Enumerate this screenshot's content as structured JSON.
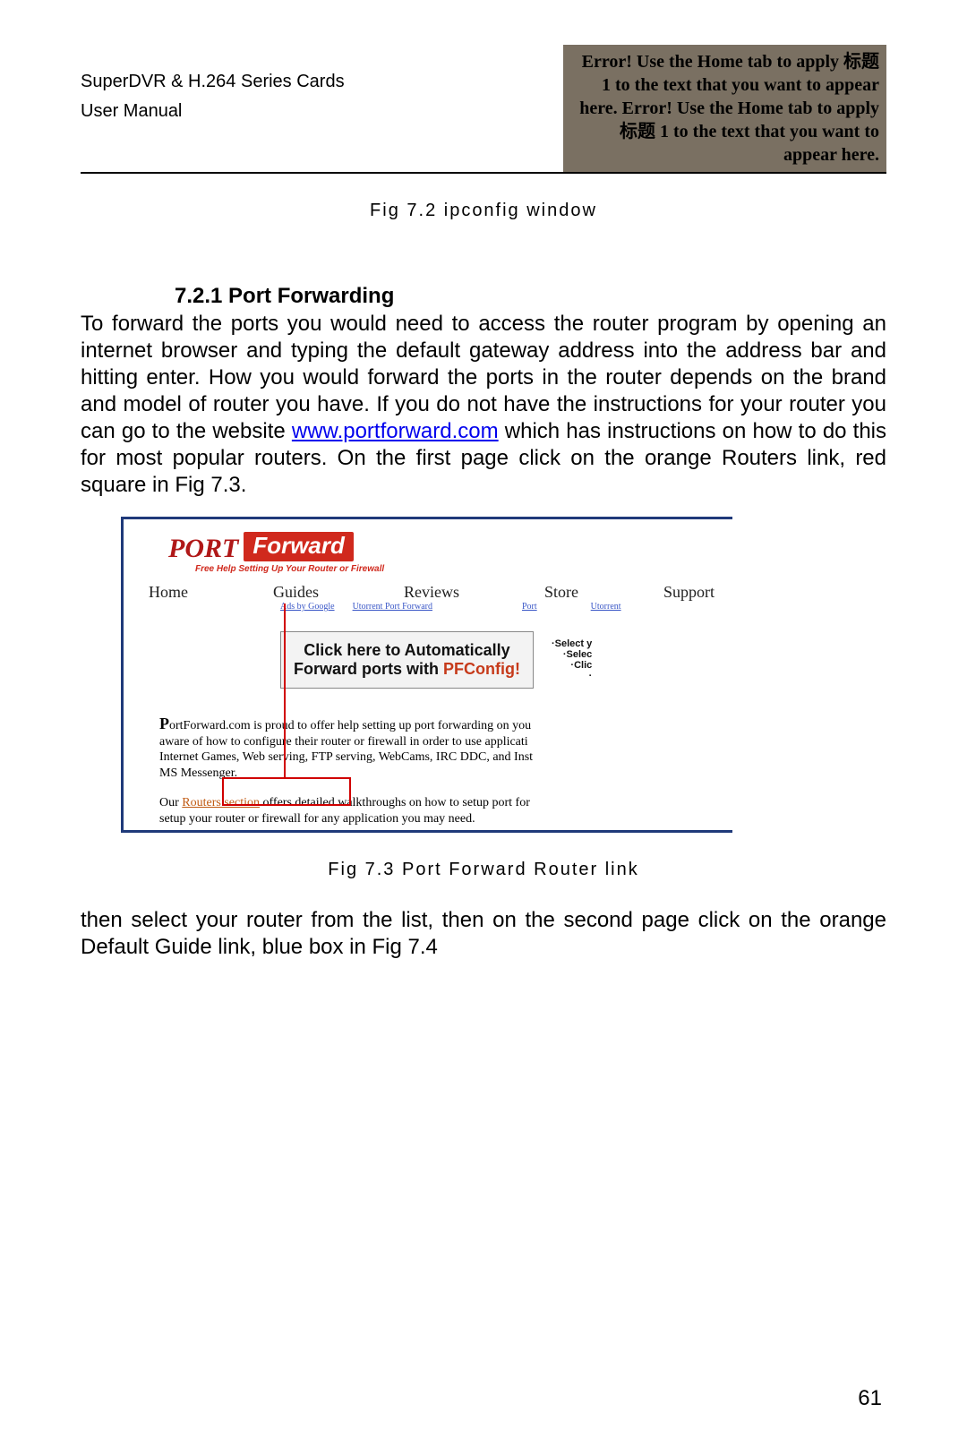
{
  "header": {
    "left_line1": "SuperDVR & H.264 Series Cards",
    "left_line2": "User Manual",
    "right_text": "Error! Use the Home tab to apply 标题 1 to the text that you want to appear here. Error! Use the Home tab to apply 标题 1 to the text that you want to appear here."
  },
  "fig72_caption": "Fig 7.2 ipconfig window",
  "section": {
    "number_title": "7.2.1  Port Forwarding",
    "para1_a": "To forward the ports you would need to access the router program by opening an internet browser and typing the default gateway address into the address bar and hitting enter. How you would forward the ports in the router depends on the brand and model of router you have. If you do not have the instructions for your router you can go to the website ",
    "link1": "www.portforward.com",
    "para1_b": " which has instructions on how to do this for most popular routers. On the first page click on the orange Routers link, red square in Fig 7.3."
  },
  "portforward": {
    "logo_port": "PORT",
    "logo_fwd": "Forward",
    "tagline": "Free Help Setting Up Your Router or Firewall",
    "nav": [
      "Home",
      "Guides",
      "Reviews",
      "Store",
      "Support"
    ],
    "subnav": [
      "Ads by Google",
      "Utorrent Port Forward",
      "Port",
      "Utorrent"
    ],
    "box_line1": "Click here to Automatically",
    "box_line2a": "Forward ports with ",
    "box_line2b": "PFConfig!",
    "side": [
      "·Select y",
      "·Selec",
      "·Clic",
      "·"
    ],
    "body1": "ortForward.com is proud to offer help setting up port forwarding on you",
    "body1_drop": "P",
    "body2": "aware of how to configure their router or firewall in order to use applicati",
    "body3": "Internet Games, Web serving, FTP serving, WebCams, IRC DDC, and Inst",
    "body4": "MS Messenger.",
    "body5_drop": "O",
    "body5a": "ur ",
    "body5_link": "Routers section",
    "body5b": " offers detailed walkthroughs on how to setup port for",
    "body6": "setup your router or firewall for any application you may need."
  },
  "fig73_caption": "Fig 7.3 Port Forward Router link",
  "after_text": "then select your router from the list, then on the second page click on the orange Default Guide link, blue box in Fig 7.4",
  "page_number": "61"
}
